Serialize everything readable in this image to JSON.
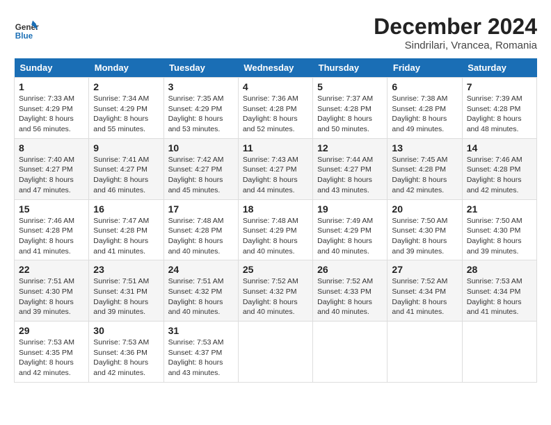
{
  "header": {
    "logo_line1": "General",
    "logo_line2": "Blue",
    "month": "December 2024",
    "location": "Sindrilari, Vrancea, Romania"
  },
  "weekdays": [
    "Sunday",
    "Monday",
    "Tuesday",
    "Wednesday",
    "Thursday",
    "Friday",
    "Saturday"
  ],
  "weeks": [
    [
      {
        "day": "1",
        "sunrise": "7:33 AM",
        "sunset": "4:29 PM",
        "daylight": "8 hours and 56 minutes."
      },
      {
        "day": "2",
        "sunrise": "7:34 AM",
        "sunset": "4:29 PM",
        "daylight": "8 hours and 55 minutes."
      },
      {
        "day": "3",
        "sunrise": "7:35 AM",
        "sunset": "4:29 PM",
        "daylight": "8 hours and 53 minutes."
      },
      {
        "day": "4",
        "sunrise": "7:36 AM",
        "sunset": "4:28 PM",
        "daylight": "8 hours and 52 minutes."
      },
      {
        "day": "5",
        "sunrise": "7:37 AM",
        "sunset": "4:28 PM",
        "daylight": "8 hours and 50 minutes."
      },
      {
        "day": "6",
        "sunrise": "7:38 AM",
        "sunset": "4:28 PM",
        "daylight": "8 hours and 49 minutes."
      },
      {
        "day": "7",
        "sunrise": "7:39 AM",
        "sunset": "4:28 PM",
        "daylight": "8 hours and 48 minutes."
      }
    ],
    [
      {
        "day": "8",
        "sunrise": "7:40 AM",
        "sunset": "4:27 PM",
        "daylight": "8 hours and 47 minutes."
      },
      {
        "day": "9",
        "sunrise": "7:41 AM",
        "sunset": "4:27 PM",
        "daylight": "8 hours and 46 minutes."
      },
      {
        "day": "10",
        "sunrise": "7:42 AM",
        "sunset": "4:27 PM",
        "daylight": "8 hours and 45 minutes."
      },
      {
        "day": "11",
        "sunrise": "7:43 AM",
        "sunset": "4:27 PM",
        "daylight": "8 hours and 44 minutes."
      },
      {
        "day": "12",
        "sunrise": "7:44 AM",
        "sunset": "4:27 PM",
        "daylight": "8 hours and 43 minutes."
      },
      {
        "day": "13",
        "sunrise": "7:45 AM",
        "sunset": "4:28 PM",
        "daylight": "8 hours and 42 minutes."
      },
      {
        "day": "14",
        "sunrise": "7:46 AM",
        "sunset": "4:28 PM",
        "daylight": "8 hours and 42 minutes."
      }
    ],
    [
      {
        "day": "15",
        "sunrise": "7:46 AM",
        "sunset": "4:28 PM",
        "daylight": "8 hours and 41 minutes."
      },
      {
        "day": "16",
        "sunrise": "7:47 AM",
        "sunset": "4:28 PM",
        "daylight": "8 hours and 41 minutes."
      },
      {
        "day": "17",
        "sunrise": "7:48 AM",
        "sunset": "4:28 PM",
        "daylight": "8 hours and 40 minutes."
      },
      {
        "day": "18",
        "sunrise": "7:48 AM",
        "sunset": "4:29 PM",
        "daylight": "8 hours and 40 minutes."
      },
      {
        "day": "19",
        "sunrise": "7:49 AM",
        "sunset": "4:29 PM",
        "daylight": "8 hours and 40 minutes."
      },
      {
        "day": "20",
        "sunrise": "7:50 AM",
        "sunset": "4:30 PM",
        "daylight": "8 hours and 39 minutes."
      },
      {
        "day": "21",
        "sunrise": "7:50 AM",
        "sunset": "4:30 PM",
        "daylight": "8 hours and 39 minutes."
      }
    ],
    [
      {
        "day": "22",
        "sunrise": "7:51 AM",
        "sunset": "4:30 PM",
        "daylight": "8 hours and 39 minutes."
      },
      {
        "day": "23",
        "sunrise": "7:51 AM",
        "sunset": "4:31 PM",
        "daylight": "8 hours and 39 minutes."
      },
      {
        "day": "24",
        "sunrise": "7:51 AM",
        "sunset": "4:32 PM",
        "daylight": "8 hours and 40 minutes."
      },
      {
        "day": "25",
        "sunrise": "7:52 AM",
        "sunset": "4:32 PM",
        "daylight": "8 hours and 40 minutes."
      },
      {
        "day": "26",
        "sunrise": "7:52 AM",
        "sunset": "4:33 PM",
        "daylight": "8 hours and 40 minutes."
      },
      {
        "day": "27",
        "sunrise": "7:52 AM",
        "sunset": "4:34 PM",
        "daylight": "8 hours and 41 minutes."
      },
      {
        "day": "28",
        "sunrise": "7:53 AM",
        "sunset": "4:34 PM",
        "daylight": "8 hours and 41 minutes."
      }
    ],
    [
      {
        "day": "29",
        "sunrise": "7:53 AM",
        "sunset": "4:35 PM",
        "daylight": "8 hours and 42 minutes."
      },
      {
        "day": "30",
        "sunrise": "7:53 AM",
        "sunset": "4:36 PM",
        "daylight": "8 hours and 42 minutes."
      },
      {
        "day": "31",
        "sunrise": "7:53 AM",
        "sunset": "4:37 PM",
        "daylight": "8 hours and 43 minutes."
      },
      null,
      null,
      null,
      null
    ]
  ]
}
